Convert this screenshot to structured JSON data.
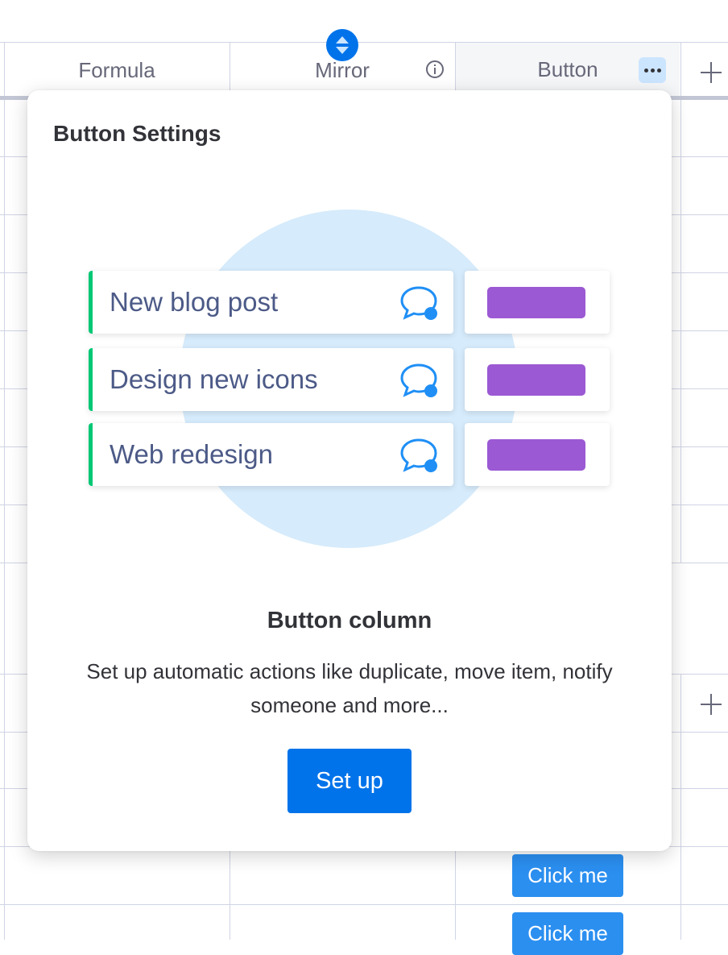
{
  "board": {
    "columns": [
      {
        "label": "Formula"
      },
      {
        "label": "Mirror"
      },
      {
        "label": "Button"
      }
    ],
    "cell_buttons": [
      "Click me",
      "Click me"
    ]
  },
  "popover": {
    "title": "Button Settings",
    "illustration": {
      "items": [
        {
          "label": "New blog post"
        },
        {
          "label": "Design new icons"
        },
        {
          "label": "Web redesign"
        }
      ]
    },
    "section_title": "Button column",
    "description": "Set up automatic actions like duplicate, move item, notify someone and more...",
    "setup_label": "Set up"
  },
  "colors": {
    "primary": "#0073ea",
    "status_green": "#00c875",
    "button_purple": "#9b59d3",
    "illustration_circle": "#d6ebfb",
    "cell_button": "#2b8ff0"
  },
  "icons": [
    "info-icon",
    "sort-handle-icon",
    "more-icon",
    "plus-icon",
    "chat-bubble-icon"
  ]
}
